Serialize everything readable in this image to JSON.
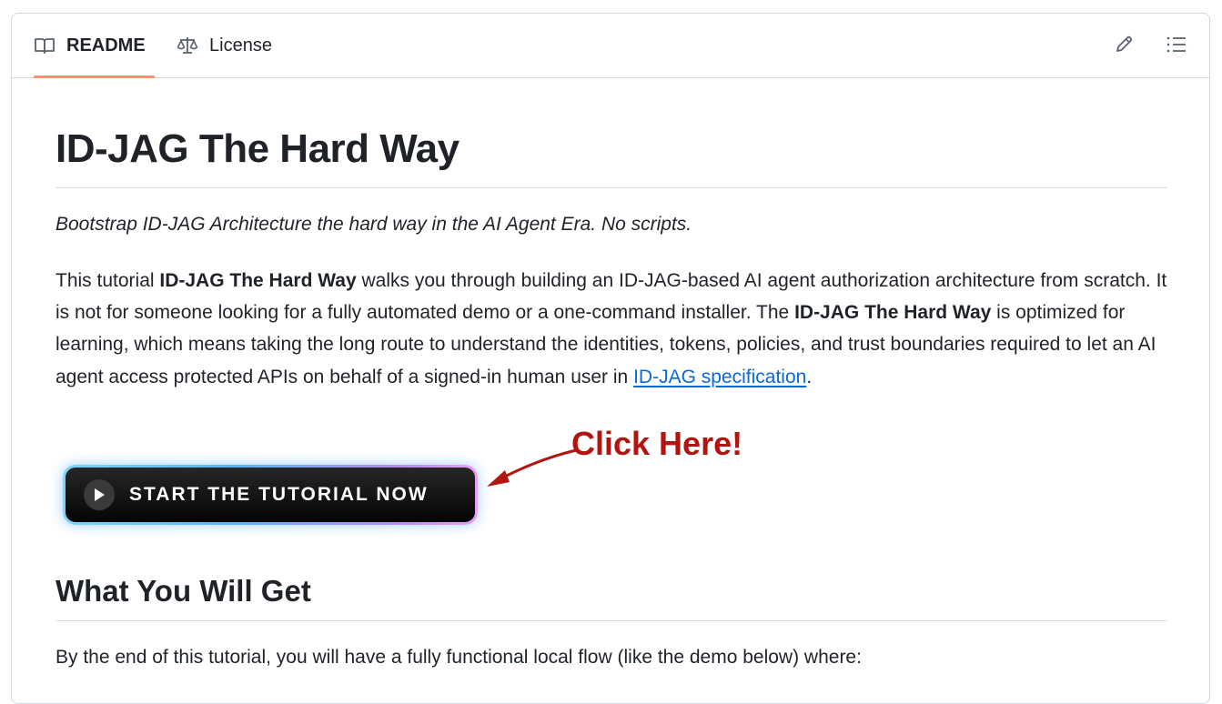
{
  "tabs": {
    "readme": "README",
    "license": "License"
  },
  "toolbar": {
    "edit_icon": "pencil-icon",
    "outline_icon": "list-icon"
  },
  "readme": {
    "title": "ID-JAG The Hard Way",
    "tagline": "Bootstrap ID-JAG Architecture the hard way in the AI Agent Era. No scripts.",
    "intro": {
      "p1_prefix": "This tutorial ",
      "p1_bold": "ID-JAG The Hard Way",
      "p1_mid": " walks you through building an ID-JAG-based AI agent authorization architecture from scratch. It is not for someone looking for a fully automated demo or a one-command installer. The ",
      "p1_bold2": "ID-JAG The Hard Way",
      "p1_rest": " is optimized for learning, which means taking the long route to understand the identities, tokens, policies, and trust boundaries required to let an AI agent access protected APIs on behalf of a signed-in human user in ",
      "link_text": "ID-JAG specification",
      "p1_end": "."
    },
    "cta_label": "START THE TUTORIAL NOW",
    "annotation": "Click Here!",
    "section_title": "What You Will Get",
    "section_text": "By the end of this tutorial, you will have a fully functional local flow (like the demo below) where:"
  },
  "colors": {
    "tab_underline": "#fd8c73",
    "link": "#0969da",
    "annotation": "#b3140f"
  }
}
